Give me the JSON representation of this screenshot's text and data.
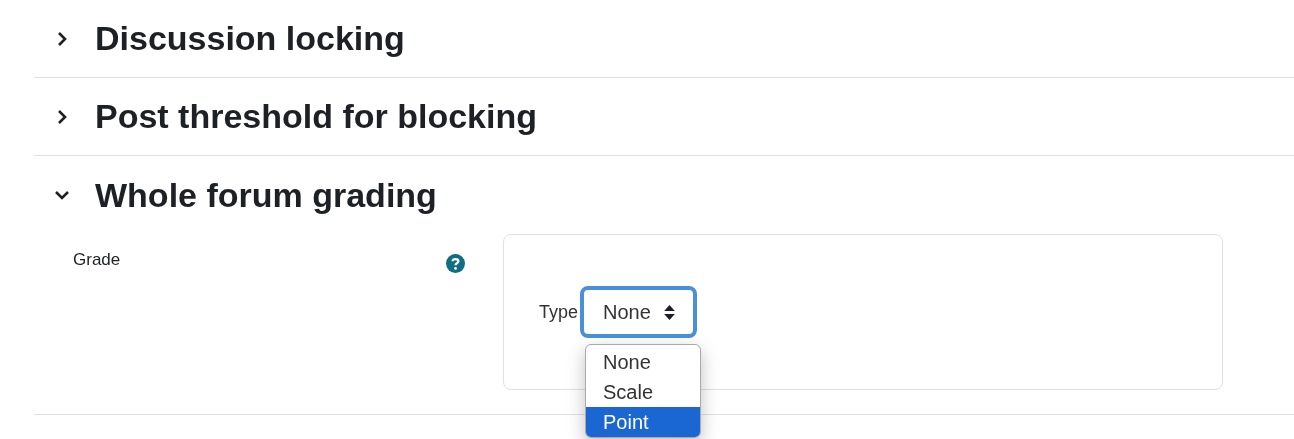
{
  "sections": [
    {
      "title": "Discussion locking",
      "expanded": false
    },
    {
      "title": "Post threshold for blocking",
      "expanded": false
    },
    {
      "title": "Whole forum grading",
      "expanded": true,
      "field": {
        "label": "Grade",
        "type_label": "Type",
        "select": {
          "value": "None",
          "open": true,
          "options": [
            {
              "label": "None",
              "highlighted": false
            },
            {
              "label": "Scale",
              "highlighted": false
            },
            {
              "label": "Point",
              "highlighted": true
            }
          ]
        }
      }
    }
  ]
}
